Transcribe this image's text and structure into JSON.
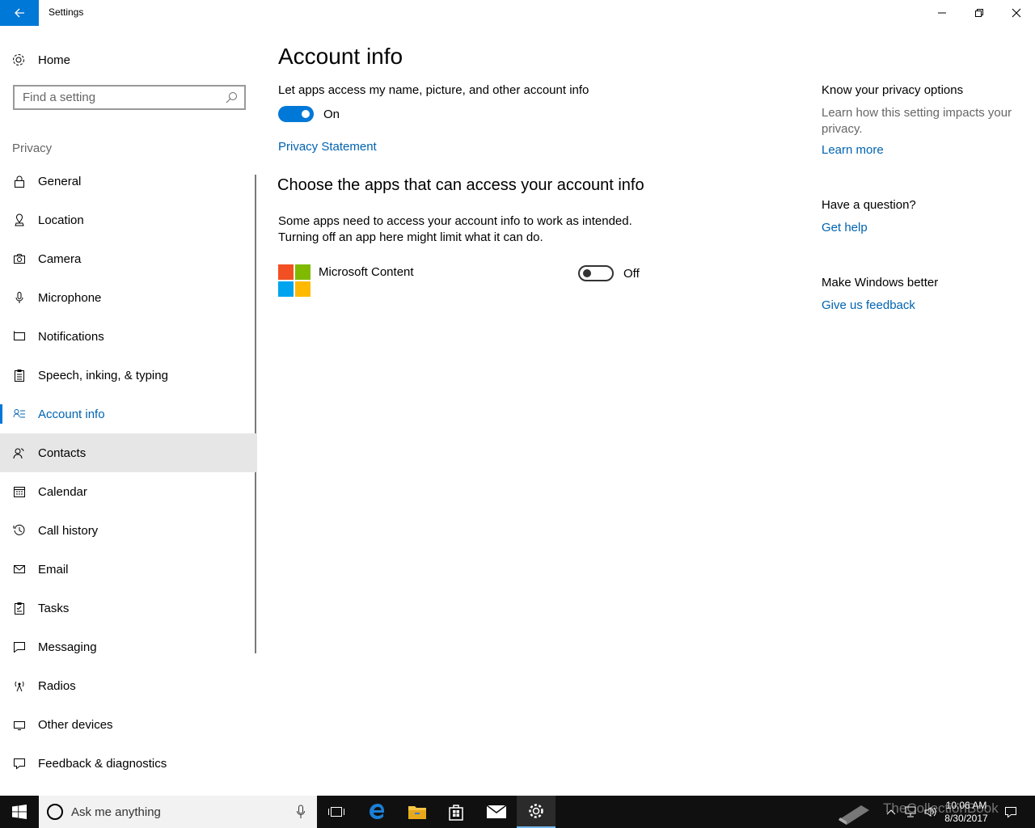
{
  "window": {
    "title": "Settings"
  },
  "sidebar": {
    "home_label": "Home",
    "search_placeholder": "Find a setting",
    "section_label": "Privacy",
    "items": [
      {
        "label": "General",
        "icon": "lock-icon"
      },
      {
        "label": "Location",
        "icon": "location-icon"
      },
      {
        "label": "Camera",
        "icon": "camera-icon"
      },
      {
        "label": "Microphone",
        "icon": "microphone-icon"
      },
      {
        "label": "Notifications",
        "icon": "notifications-icon"
      },
      {
        "label": "Speech, inking, & typing",
        "icon": "clipboard-icon"
      },
      {
        "label": "Account info",
        "icon": "account-info-icon",
        "active": true
      },
      {
        "label": "Contacts",
        "icon": "contacts-icon",
        "hover": true
      },
      {
        "label": "Calendar",
        "icon": "calendar-icon"
      },
      {
        "label": "Call history",
        "icon": "history-icon"
      },
      {
        "label": "Email",
        "icon": "email-icon"
      },
      {
        "label": "Tasks",
        "icon": "tasks-icon"
      },
      {
        "label": "Messaging",
        "icon": "messaging-icon"
      },
      {
        "label": "Radios",
        "icon": "radios-icon"
      },
      {
        "label": "Other devices",
        "icon": "other-devices-icon"
      },
      {
        "label": "Feedback & diagnostics",
        "icon": "feedback-icon"
      }
    ]
  },
  "main": {
    "title": "Account info",
    "access_label": "Let apps access my name, picture, and other account info",
    "access_toggle_state": "On",
    "privacy_link": "Privacy Statement",
    "apps_heading": "Choose the apps that can access your account info",
    "apps_desc_line1": "Some apps need to access your account info to work as intended.",
    "apps_desc_line2": "Turning off an app here might limit what it can do.",
    "apps": [
      {
        "name": "Microsoft Content",
        "state": "Off"
      }
    ]
  },
  "right_panel": {
    "privacy_heading": "Know your privacy options",
    "privacy_text": "Learn how this setting impacts your privacy.",
    "learn_more": "Learn more",
    "question_heading": "Have a question?",
    "get_help": "Get help",
    "better_heading": "Make Windows better",
    "feedback_link": "Give us feedback"
  },
  "taskbar": {
    "search_placeholder": "Ask me anything",
    "time": "10:06 AM",
    "date": "8/30/2017",
    "watermark": "TheCollectionBook"
  },
  "colors": {
    "accent": "#0078d7",
    "link": "#0063b1",
    "secondary_text": "#666666",
    "taskbar": "#101010"
  }
}
